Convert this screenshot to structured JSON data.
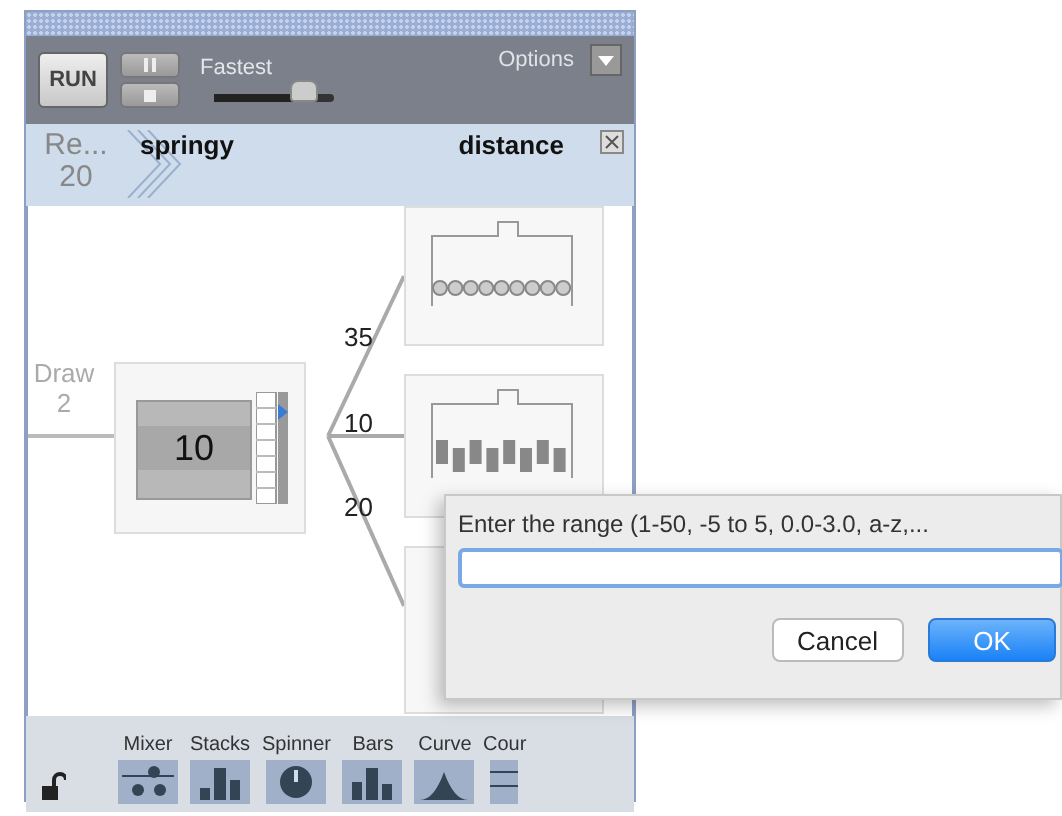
{
  "toolbar": {
    "run_label": "RUN",
    "speed_label": "Fastest",
    "speed": {
      "level": 0.75
    },
    "options_label": "Options"
  },
  "header": {
    "repeat_label": "Re...",
    "repeat_value": "20",
    "left_title": "springy",
    "right_title": "distance"
  },
  "diagram": {
    "source_label": "Draw",
    "source_value": "2",
    "spinner_value": "10",
    "branches": [
      {
        "label": "35"
      },
      {
        "label": "10"
      },
      {
        "label": "20"
      }
    ]
  },
  "palette": {
    "locked": false,
    "items": [
      {
        "label": "Mixer",
        "kind": "mixer"
      },
      {
        "label": "Stacks",
        "kind": "stacks"
      },
      {
        "label": "Spinner",
        "kind": "spinner"
      },
      {
        "label": "Bars",
        "kind": "bars"
      },
      {
        "label": "Curve",
        "kind": "curve"
      },
      {
        "label": "Cour",
        "kind": "counter"
      }
    ]
  },
  "dialog": {
    "prompt": "Enter the range (1-50, -5 to 5, 0.0-3.0, a-z,...",
    "cancel_label": "Cancel",
    "ok_label": "OK"
  }
}
